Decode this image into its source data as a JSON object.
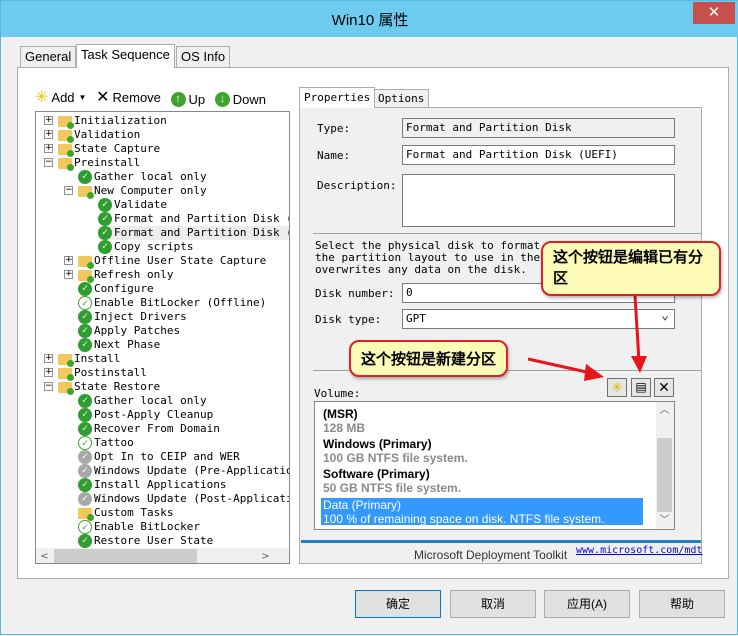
{
  "window": {
    "title": "Win10 属性",
    "close_icon": "close-icon"
  },
  "tabs": [
    "General",
    "Task Sequence",
    "OS Info"
  ],
  "toolbar": {
    "add": "Add",
    "remove": "Remove",
    "up": "Up",
    "down": "Down"
  },
  "tree": [
    {
      "label": "Initialization",
      "level": 0,
      "type": "folder",
      "exp": "+"
    },
    {
      "label": "Validation",
      "level": 0,
      "type": "folder",
      "exp": "+"
    },
    {
      "label": "State Capture",
      "level": 0,
      "type": "folder",
      "exp": "+"
    },
    {
      "label": "Preinstall",
      "level": 0,
      "type": "folder",
      "exp": "-"
    },
    {
      "label": "Gather local only",
      "level": 1,
      "type": "check"
    },
    {
      "label": "New Computer only",
      "level": 1,
      "type": "folder",
      "exp": "-"
    },
    {
      "label": "Validate",
      "level": 2,
      "type": "check"
    },
    {
      "label": "Format and Partition Disk (",
      "level": 2,
      "type": "check"
    },
    {
      "label": "Format and Partition Disk (",
      "level": 2,
      "type": "check",
      "selected": true
    },
    {
      "label": "Copy scripts",
      "level": 2,
      "type": "check"
    },
    {
      "label": "Offline User State Capture",
      "level": 1,
      "type": "folder",
      "exp": "+"
    },
    {
      "label": "Refresh only",
      "level": 1,
      "type": "folder",
      "exp": "+"
    },
    {
      "label": "Configure",
      "level": 1,
      "type": "check"
    },
    {
      "label": "Enable BitLocker (Offline)",
      "level": 1,
      "type": "light"
    },
    {
      "label": "Inject Drivers",
      "level": 1,
      "type": "check"
    },
    {
      "label": "Apply Patches",
      "level": 1,
      "type": "check"
    },
    {
      "label": "Next Phase",
      "level": 1,
      "type": "check"
    },
    {
      "label": "Install",
      "level": 0,
      "type": "folder",
      "exp": "+"
    },
    {
      "label": "Postinstall",
      "level": 0,
      "type": "folder",
      "exp": "+"
    },
    {
      "label": "State Restore",
      "level": 0,
      "type": "folder",
      "exp": "-"
    },
    {
      "label": "Gather local only",
      "level": 1,
      "type": "check"
    },
    {
      "label": "Post-Apply Cleanup",
      "level": 1,
      "type": "check"
    },
    {
      "label": "Recover From Domain",
      "level": 1,
      "type": "check"
    },
    {
      "label": "Tattoo",
      "level": 1,
      "type": "light"
    },
    {
      "label": "Opt In to CEIP and WER",
      "level": 1,
      "type": "gray"
    },
    {
      "label": "Windows Update (Pre-Applicatio",
      "level": 1,
      "type": "gray"
    },
    {
      "label": "Install Applications",
      "level": 1,
      "type": "check"
    },
    {
      "label": "Windows Update (Post-Applicati",
      "level": 1,
      "type": "gray"
    },
    {
      "label": "Custom Tasks",
      "level": 1,
      "type": "folder"
    },
    {
      "label": "Enable BitLocker",
      "level": 1,
      "type": "light"
    },
    {
      "label": "Restore User State",
      "level": 1,
      "type": "check"
    }
  ],
  "right": {
    "tabs": [
      "Properties",
      "Options"
    ],
    "type_label": "Type:",
    "type_value": "Format and Partition Disk",
    "name_label": "Name:",
    "name_value": "Format and Partition Disk (UEFI)",
    "desc_label": "Description:",
    "desc_value": "",
    "instructions": [
      "Select the physical disk to format and",
      "the partition layout to use in the li",
      "overwrites any data on the disk."
    ],
    "disk_number_label": "Disk number:",
    "disk_number_value": "0",
    "disk_type_label": "Disk type:",
    "disk_type_value": "GPT",
    "volume_label": "Volume:",
    "volumes": [
      {
        "name": " (MSR)",
        "detail": "128 MB"
      },
      {
        "name": "Windows (Primary)",
        "detail": "100 GB NTFS file system."
      },
      {
        "name": "Software (Primary)",
        "detail": "50 GB NTFS file system."
      },
      {
        "name": "Data (Primary)",
        "detail": "100 % of remaining space on disk. NTFS file system.",
        "selected": true
      }
    ],
    "footer_text": "Microsoft Deployment Toolkit",
    "footer_link": "www.microsoft.com/mdt"
  },
  "callouts": {
    "edit": "这个按钮是编辑已有分区",
    "new": "这个按钮是新建分区"
  },
  "buttons": {
    "ok": "确定",
    "cancel": "取消",
    "apply": "应用(A)",
    "help": "帮助"
  },
  "colors": {
    "titlebar": "#6ccbef",
    "selection": "#3399ff",
    "callout_border": "#d9232a",
    "callout_fill": "#fefcb6"
  }
}
